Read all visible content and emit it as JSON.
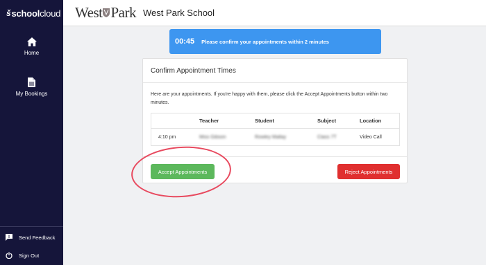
{
  "sidebar": {
    "logo": {
      "mark": "š",
      "bold": "school",
      "rest": "cloud"
    },
    "nav": [
      {
        "label": "Home",
        "icon": "home-icon"
      },
      {
        "label": "My Bookings",
        "icon": "document-icon"
      }
    ],
    "bottom": [
      {
        "label": "Send Feedback",
        "icon": "feedback-icon"
      },
      {
        "label": "Sign Out",
        "icon": "power-icon"
      }
    ]
  },
  "header": {
    "logo_left": "West",
    "logo_right": "Park",
    "school_name": "West Park School"
  },
  "timer": {
    "time": "00:45",
    "message": "Please confirm your appointments within 2 minutes"
  },
  "card": {
    "title": "Confirm Appointment Times",
    "intro": "Here are your appointments. If you're happy with them, please click the Accept Appointments button within two minutes.",
    "columns": [
      "",
      "Teacher",
      "Student",
      "Subject",
      "Location"
    ],
    "rows": [
      {
        "time": "4:10 pm",
        "teacher": "Miss Gibson",
        "student": "Rowley Mallay",
        "subject": "Class 7T",
        "location": "Video Call"
      }
    ],
    "accept_label": "Accept Appointments",
    "reject_label": "Reject Appointments"
  },
  "colors": {
    "sidebar_bg": "#15153a",
    "timer_bg": "#3d96f0",
    "accept": "#5cb85c",
    "reject": "#e02f2f",
    "annotation": "#e84a5f"
  }
}
